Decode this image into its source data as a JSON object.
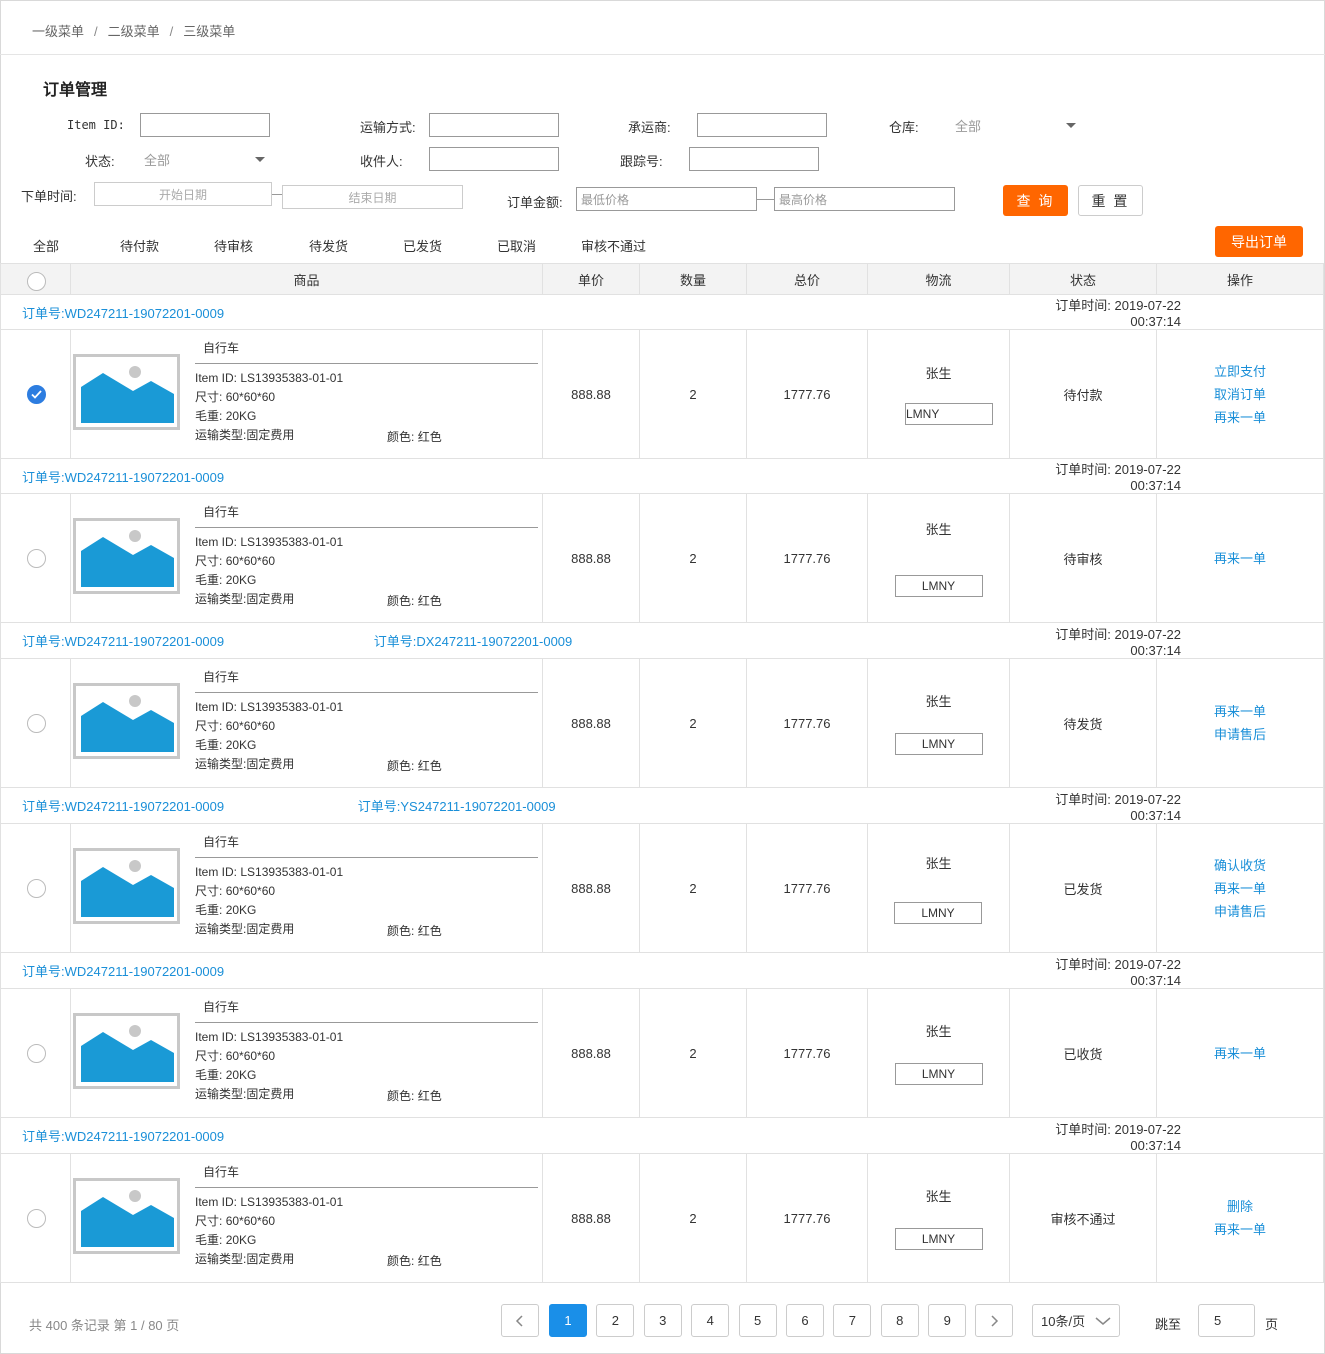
{
  "breadcrumb": [
    "一级菜单",
    "二级菜单",
    "三级菜单"
  ],
  "breadcrumb_sep": "/",
  "page_title": "订单管理",
  "filters": {
    "item_id_label": "Item ID:",
    "shipping_label": "运输方式:",
    "carrier_label": "承运商:",
    "warehouse_label": "仓库:",
    "warehouse_value": "全部",
    "status_label": "状态:",
    "status_value": "全部",
    "recipient_label": "收件人:",
    "tracking_label": "跟踪号:",
    "order_time_label": "下单时间:",
    "start_date_placeholder": "开始日期",
    "end_date_placeholder": "结束日期",
    "amount_label": "订单金额:",
    "min_price_placeholder": "最低价格",
    "max_price_placeholder": "最高价格",
    "query_button": "查 询",
    "reset_button": "重 置"
  },
  "tabs": [
    "全部",
    "待付款",
    "待审核",
    "待发货",
    "已发货",
    "已取消",
    "审核不通过"
  ],
  "export_button": "导出订单",
  "columns": [
    "商品",
    "单价",
    "数量",
    "总价",
    "物流",
    "状态",
    "操作"
  ],
  "order_no_label": "订单号:",
  "order_time_label": "订单时间:",
  "product_labels": {
    "item_id": "Item ID:",
    "size": "尺寸:",
    "weight": "毛重:",
    "ship_type": "运输类型:",
    "color": "颜色:"
  },
  "orders": [
    {
      "order_no": "WD247211-19072201-0009",
      "extra_no": "",
      "time": "2019-07-22 00:37:14",
      "checked": true,
      "product": {
        "name": "自行车",
        "item_id": "LS13935383-01-01",
        "size": "60*60*60",
        "weight": "20KG",
        "ship_type": "固定费用",
        "color": "红色"
      },
      "price": "888.88",
      "qty": "2",
      "total": "1777.76",
      "recipient": "张生",
      "logistics": "LMNY",
      "status": "待付款",
      "actions": [
        "立即支付",
        "取消订单",
        "再来一单"
      ]
    },
    {
      "order_no": "WD247211-19072201-0009",
      "extra_no": "",
      "time": "2019-07-22 00:37:14",
      "checked": false,
      "product": {
        "name": "自行车",
        "item_id": "LS13935383-01-01",
        "size": "60*60*60",
        "weight": "20KG",
        "ship_type": "固定费用",
        "color": "红色"
      },
      "price": "888.88",
      "qty": "2",
      "total": "1777.76",
      "recipient": "张生",
      "logistics": "LMNY",
      "status": "待审核",
      "actions": [
        "再来一单"
      ]
    },
    {
      "order_no": "WD247211-19072201-0009",
      "extra_no": "DX247211-19072201-0009",
      "time": "2019-07-22 00:37:14",
      "checked": false,
      "product": {
        "name": "自行车",
        "item_id": "LS13935383-01-01",
        "size": "60*60*60",
        "weight": "20KG",
        "ship_type": "固定费用",
        "color": "红色"
      },
      "price": "888.88",
      "qty": "2",
      "total": "1777.76",
      "recipient": "张生",
      "logistics": "LMNY",
      "status": "待发货",
      "actions": [
        "再来一单",
        "申请售后"
      ]
    },
    {
      "order_no": "WD247211-19072201-0009",
      "extra_no": "YS247211-19072201-0009",
      "time": "2019-07-22 00:37:14",
      "checked": false,
      "product": {
        "name": "自行车",
        "item_id": "LS13935383-01-01",
        "size": "60*60*60",
        "weight": "20KG",
        "ship_type": "固定费用",
        "color": "红色"
      },
      "price": "888.88",
      "qty": "2",
      "total": "1777.76",
      "recipient": "张生",
      "logistics": "LMNY",
      "status": "已发货",
      "actions": [
        "确认收货",
        "再来一单",
        "申请售后"
      ]
    },
    {
      "order_no": "WD247211-19072201-0009",
      "extra_no": "",
      "time": "2019-07-22 00:37:14",
      "checked": false,
      "product": {
        "name": "自行车",
        "item_id": "LS13935383-01-01",
        "size": "60*60*60",
        "weight": "20KG",
        "ship_type": "固定费用",
        "color": "红色"
      },
      "price": "888.88",
      "qty": "2",
      "total": "1777.76",
      "recipient": "张生",
      "logistics": "LMNY",
      "status": "已收货",
      "actions": [
        "再来一单"
      ]
    },
    {
      "order_no": "WD247211-19072201-0009",
      "extra_no": "",
      "time": "2019-07-22 00:37:14",
      "checked": false,
      "product": {
        "name": "自行车",
        "item_id": "LS13935383-01-01",
        "size": "60*60*60",
        "weight": "20KG",
        "ship_type": "固定费用",
        "color": "红色"
      },
      "price": "888.88",
      "qty": "2",
      "total": "1777.76",
      "recipient": "张生",
      "logistics": "LMNY",
      "status": "审核不通过",
      "actions": [
        "删除",
        "再来一单"
      ]
    }
  ],
  "pagination": {
    "summary": "共 400 条记录 第 1 / 80 页",
    "pages": [
      "1",
      "2",
      "3",
      "4",
      "5",
      "6",
      "7",
      "8",
      "9"
    ],
    "current": "1",
    "page_size": "10条/页",
    "jump_label": "跳至",
    "jump_value": "5",
    "page_unit": "页"
  },
  "colors": {
    "accent": "#ff6600",
    "link": "#1a8fd8",
    "page_active": "#1a8fe8",
    "checkbox": "#2d7de0",
    "image_placeholder": "#1a9ad6"
  }
}
